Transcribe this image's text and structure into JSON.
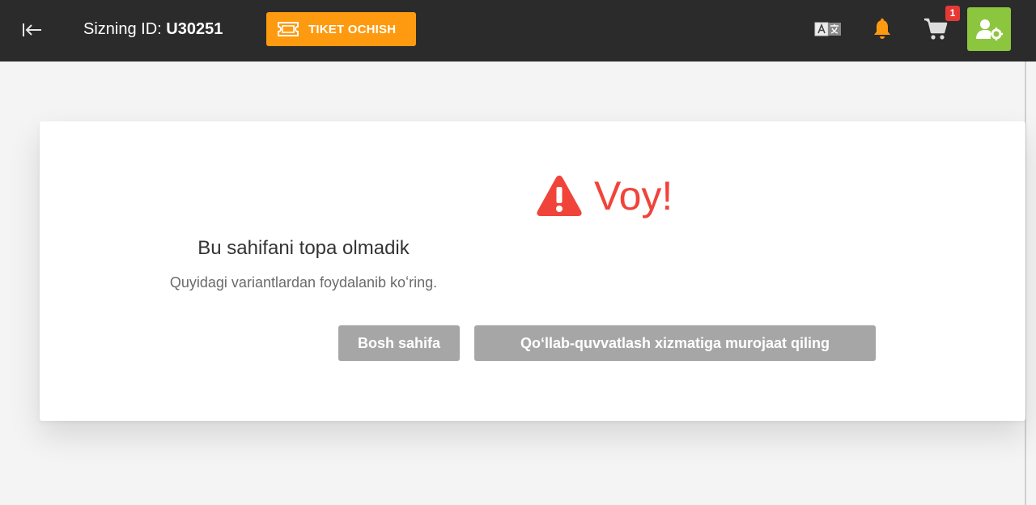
{
  "header": {
    "id_label": "Sizning ID:",
    "id_value": "U30251",
    "ticket_button_label": "TIKET OCHISH",
    "cart_badge_count": "1",
    "icons": {
      "back": "arrow-left-to-line-icon",
      "ticket": "ticket-icon",
      "language": "translate-icon",
      "notifications": "bell-icon",
      "cart": "cart-icon",
      "profile": "user-gear-icon"
    },
    "colors": {
      "background": "#2b2b2b",
      "ticket_button": "#fd9a0f",
      "bell": "#fd9a0f",
      "badge": "#e53935",
      "profile_button": "#8cc63f"
    }
  },
  "error": {
    "title": "Voy!",
    "subtitle": "Bu sahifani topa olmadik",
    "hint": "Quyidagi variantlardan foydalanib koʻring.",
    "icon": "warning-triangle-icon",
    "title_color": "#f0443a"
  },
  "actions": {
    "home_label": "Bosh sahifa",
    "support_label": "Qoʻllab-quvvatlash xizmatiga murojaat qiling",
    "button_color": "#a6a6a6"
  }
}
